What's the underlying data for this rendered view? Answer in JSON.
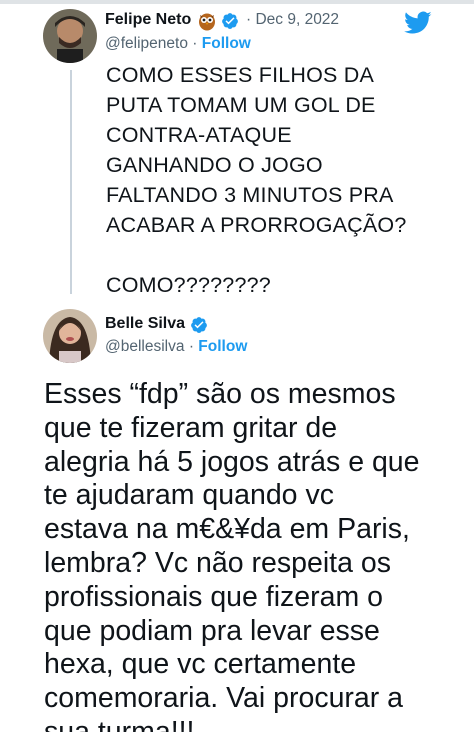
{
  "tweet1": {
    "author_name": "Felipe Neto",
    "handle": "@felipeneto",
    "separator": "·",
    "follow_label": "Follow",
    "date": "· Dec 9, 2022",
    "icons": [
      "owl-emoji-icon",
      "verified-badge-icon",
      "twitter-bird-icon"
    ],
    "text": "COMO ESSES FILHOS DA\nPUTA TOMAM UM GOL DE\nCONTRA-ATAQUE\nGANHANDO O JOGO\nFALTANDO 3 MINUTOS PRA\nACABAR A PRORROGAÇÃO?\n\nCOMO????????"
  },
  "tweet2": {
    "author_name": "Belle Silva",
    "handle": "@bellesilva",
    "separator": "·",
    "follow_label": "Follow",
    "icons": [
      "verified-badge-icon"
    ],
    "text": "Esses “fdp” são os mesmos\nque te fizeram gritar de\nalegria há 5 jogos atrás e que\nte ajudaram quando vc\nestava na m€&¥da em Paris,\nlembra? Vc não respeita os\nprofissionais que fizeram o\nque podiam pra levar esse\nhexa, que vc certamente\ncomemoraria. Vai procurar a\nsua turma!!!"
  },
  "colors": {
    "accent": "#1d9bf0",
    "secondary_text": "#536471",
    "primary_text": "#0f1419",
    "thread_line": "#c9d3dc"
  }
}
